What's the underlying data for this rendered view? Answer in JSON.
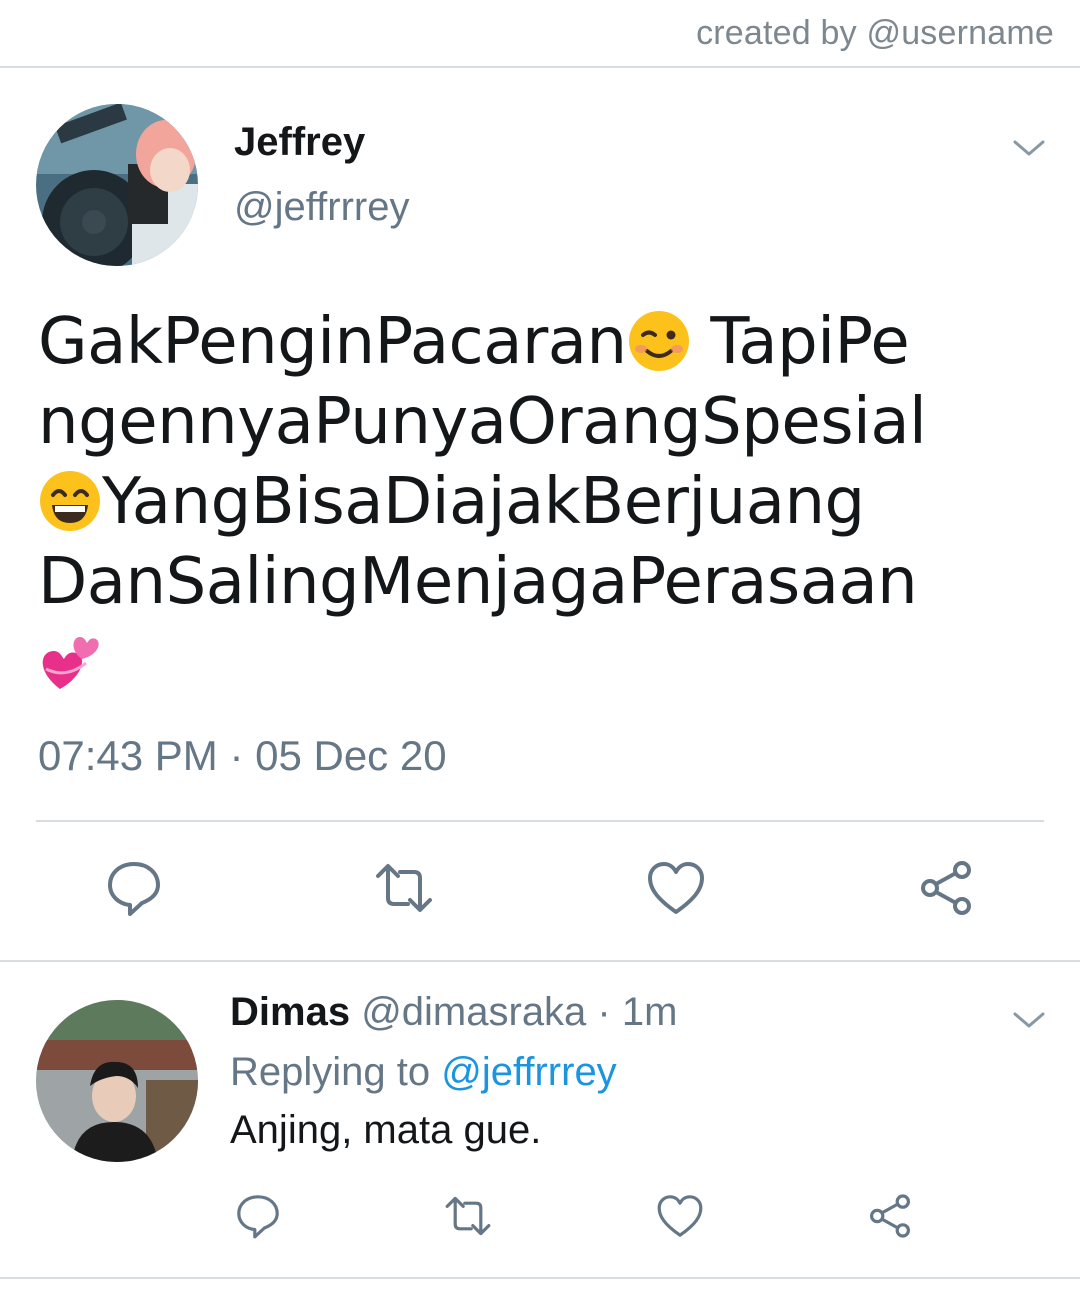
{
  "watermark": "created by @username",
  "tweet": {
    "display_name": "Jeffrey",
    "handle": "@jeffrrrey",
    "lines": [
      {
        "before": "GakPenginPacaran",
        "emoji": "wink-emoji",
        "after": " TapiPe"
      },
      {
        "before": "ngennyaPunyaOrangSpesial",
        "emoji": "",
        "after": ""
      },
      {
        "before": "",
        "emoji": "grin-emoji",
        "after": "YangBisaDiajakBerjuang"
      },
      {
        "before": "DanSalingMenjagaPerasaan",
        "emoji": "",
        "after": ""
      },
      {
        "before": "",
        "emoji": "revolving-hearts-emoji",
        "after": ""
      }
    ],
    "timestamp": "07:43 PM · 05 Dec 20"
  },
  "reply": {
    "display_name": "Dimas",
    "handle": "@dimasraka",
    "time": " · 1m",
    "replying_prefix": "Replying to ",
    "replying_mention": "@jeffrrrey",
    "text": "Anjing, mata gue."
  },
  "icons": {
    "reply": "reply-icon",
    "retweet": "retweet-icon",
    "like": "like-icon",
    "share": "share-icon",
    "menu": "chevron-down-icon"
  },
  "colors": {
    "text": "#14171a",
    "secondary": "#657786",
    "link": "#1b95e0",
    "divider": "#d8dde2"
  }
}
